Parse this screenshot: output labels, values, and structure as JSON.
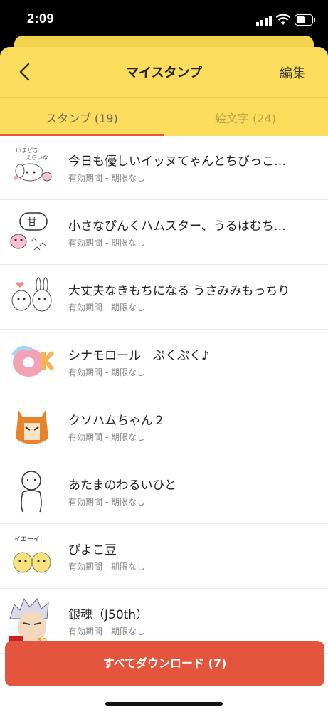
{
  "status": {
    "time": "2:09"
  },
  "header": {
    "title": "マイスタンプ",
    "edit": "編集"
  },
  "tabs": {
    "stamps": "スタンプ (19)",
    "emoji": "絵文字 (24)"
  },
  "items": [
    {
      "name": "今日も優しいイッヌてゃんとちびっこ…",
      "sub": "有効期間 - 期限なし"
    },
    {
      "name": "小さなぴんくハムスター、うるはむち…",
      "sub": "有効期間 - 期限なし"
    },
    {
      "name": "大丈夫なきもちになる うさみみもっちり",
      "sub": "有効期間 - 期限なし"
    },
    {
      "name": "シナモロール　ぷくぷく♪",
      "sub": "有効期間 - 期限なし"
    },
    {
      "name": "クソハムちゃん２",
      "sub": "有効期間 - 期限なし"
    },
    {
      "name": "あたまのわるいひと",
      "sub": "有効期間 - 期限なし"
    },
    {
      "name": "ぴよこ豆",
      "sub": "有効期間 - 期限なし"
    },
    {
      "name": "銀魂（J50th）",
      "sub": "有効期間 - 期限なし"
    }
  ],
  "download_all": "すべてダウンロード (7)",
  "colors": {
    "header": "#fbdc5c",
    "accent": "#e4553e"
  }
}
